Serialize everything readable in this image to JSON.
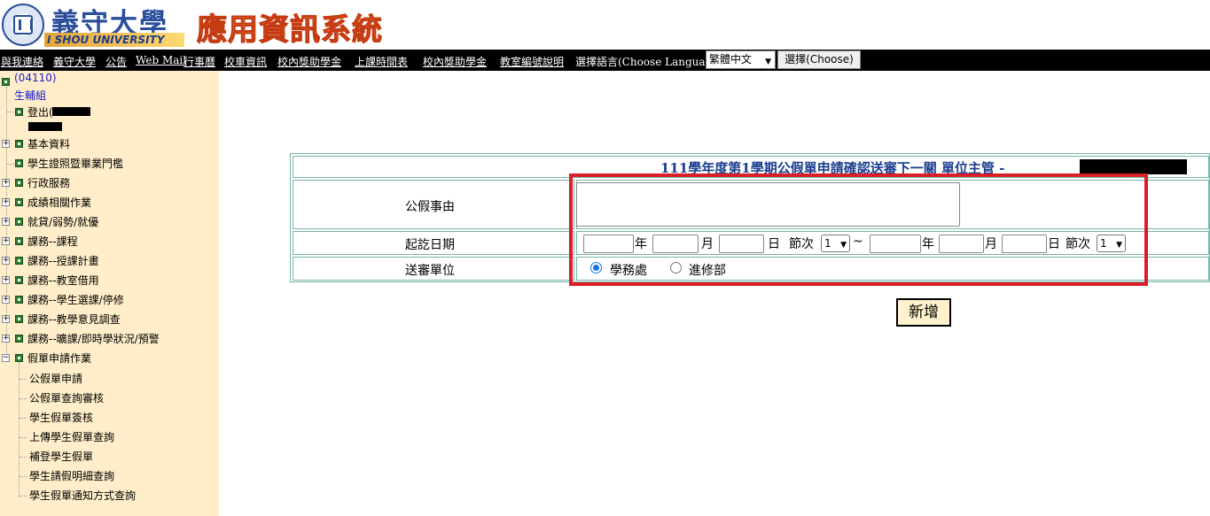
{
  "header": {
    "brand_cn": "義守大學",
    "brand_en": "I SHOU UNIVERSITY",
    "system_title": "應用資訊系統"
  },
  "nav": {
    "links": [
      "與我連絡",
      "義守大學",
      "公告",
      "Web Mail",
      "行事曆",
      "校車資訊",
      "校內獎助學金",
      "上課時間表",
      "校內獎助學金",
      "教室編號說明"
    ],
    "language_label": "選擇語言(Choose Language):",
    "language_value": "繁體中文",
    "choose_button": "選擇(Choose)"
  },
  "sidebar": {
    "user_code": "(04110)",
    "dept": "生輔組",
    "logout": "登出(",
    "menu": [
      "基本資料",
      "學生證照暨畢業門檻",
      "行政服務",
      "成績相關作業",
      "就貸/弱勢/就優",
      "課務--課程",
      "課務--授課計畫",
      "課務--教室借用",
      "課務--學生選課/停修",
      "課務--教學意見調查",
      "課務--曠課/即時學狀況/預警",
      "假單申請作業"
    ],
    "submenu": [
      "公假單申請",
      "公假單查詢審核",
      "學生假單簽核",
      "上傳學生假單查詢",
      "補登學生假單",
      "學生請假明細查詢",
      "學生假單通知方式查詢"
    ]
  },
  "form": {
    "title": "111學年度第1學期公假單申請確認送審下一關 單位主管 -",
    "reason_label": "公假事由",
    "date_label": "起訖日期",
    "unit_label": "送審單位",
    "year": "年",
    "month": "月",
    "day": "日",
    "period": "節次",
    "tilde": "~",
    "period_start": "1",
    "period_end": "1",
    "unit_options": [
      "學務處",
      "進修部"
    ],
    "selected_unit": "學務處",
    "add_button": "新增"
  }
}
